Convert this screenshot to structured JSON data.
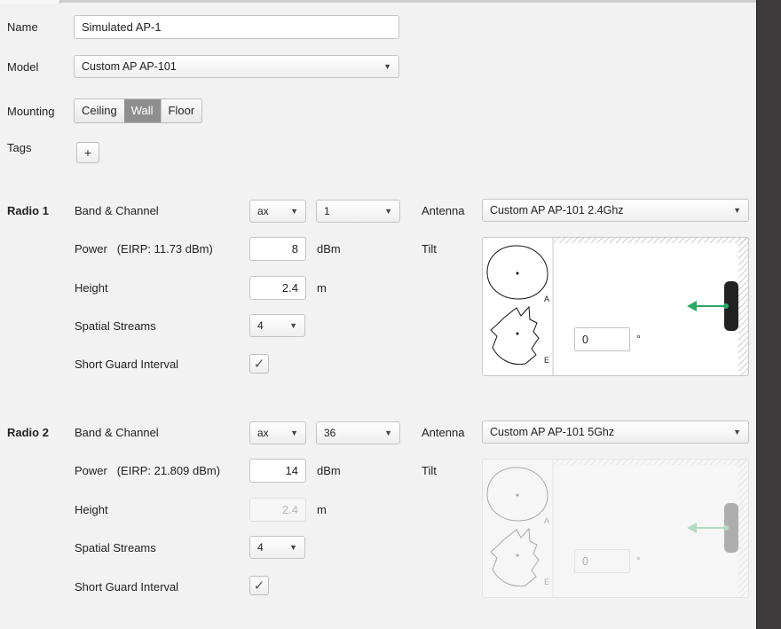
{
  "form": {
    "name_label": "Name",
    "name_value": "Simulated AP-1",
    "model_label": "Model",
    "model_value": "Custom AP AP-101",
    "mounting_label": "Mounting",
    "mounting_options": [
      "Ceiling",
      "Wall",
      "Floor"
    ],
    "mounting_selected": "Wall",
    "tags_label": "Tags",
    "tags_add": "+"
  },
  "radios": [
    {
      "title": "Radio 1",
      "band_label": "Band & Channel",
      "band": "ax",
      "channel": "1",
      "antenna_label": "Antenna",
      "antenna": "Custom AP AP-101 2.4Ghz",
      "power_label": "Power",
      "eirp": "(EIRP: 11.73 dBm)",
      "power_value": "8",
      "power_unit": "dBm",
      "tilt_label": "Tilt",
      "height_label": "Height",
      "height_value": "2.4",
      "height_unit": "m",
      "streams_label": "Spatial Streams",
      "streams": "4",
      "sgi_label": "Short Guard Interval",
      "sgi_checked": true,
      "pattern_a": "A",
      "pattern_e": "E",
      "tilt_value": "0",
      "degree_symbol": "°",
      "enabled": true
    },
    {
      "title": "Radio 2",
      "band_label": "Band & Channel",
      "band": "ax",
      "channel": "36",
      "antenna_label": "Antenna",
      "antenna": "Custom AP AP-101 5Ghz",
      "power_label": "Power",
      "eirp": "(EIRP: 21.809 dBm)",
      "power_value": "14",
      "power_unit": "dBm",
      "tilt_label": "Tilt",
      "height_label": "Height",
      "height_value": "2.4",
      "height_unit": "m",
      "streams_label": "Spatial Streams",
      "streams": "4",
      "sgi_label": "Short Guard Interval",
      "sgi_checked": true,
      "pattern_a": "A",
      "pattern_e": "E",
      "tilt_value": "0",
      "degree_symbol": "°",
      "enabled": false
    }
  ],
  "icons": {
    "dropdown_arrow": "▼",
    "checkmark": "✓"
  },
  "colors": {
    "background": "#f2f2f2",
    "selected_segment": "#8e8e8e",
    "tilt_arrow": "#2ea866",
    "ap_body": "#222222"
  }
}
